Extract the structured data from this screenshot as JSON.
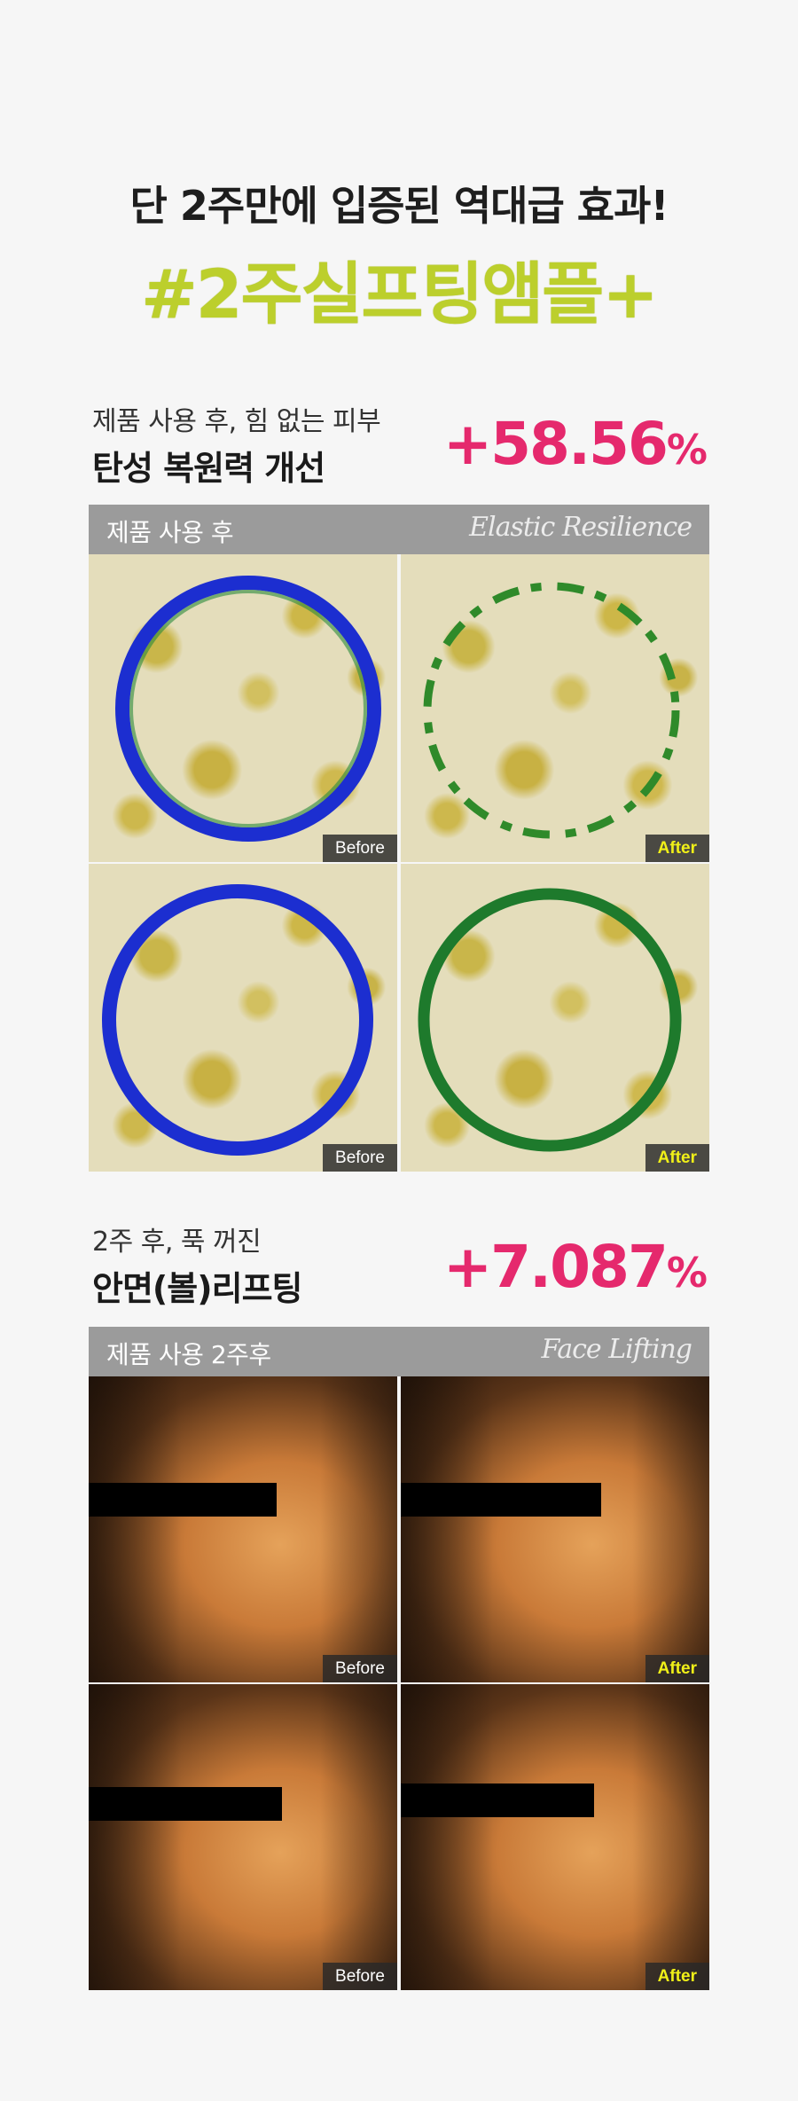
{
  "header": {
    "headline": "단 2주만에 입증된 역대급 효과!",
    "hashtag": "#2주실프팅앰플+"
  },
  "colors": {
    "accent_green": "#bccf2c",
    "accent_pink": "#e5296d",
    "after_yellow": "#f0f018",
    "panel_gray": "#9b9b9b"
  },
  "section1": {
    "subtitle": "제품 사용 후, 힘 없는 피부",
    "title": "탄성 복원력 개선",
    "value": "+58.56",
    "unit": "%",
    "panel_label": "제품 사용 후",
    "panel_label_en": "Elastic Resilience",
    "tags": [
      "Before",
      "After",
      "Before",
      "After"
    ]
  },
  "section2": {
    "subtitle": "2주 후, 푹 꺼진",
    "title": "안면(볼)리프팅",
    "value": "+7.087",
    "unit": "%",
    "panel_label": "제품 사용 2주후",
    "panel_label_en": "Face Lifting",
    "tags": [
      "Before",
      "After",
      "Before",
      "After"
    ]
  }
}
